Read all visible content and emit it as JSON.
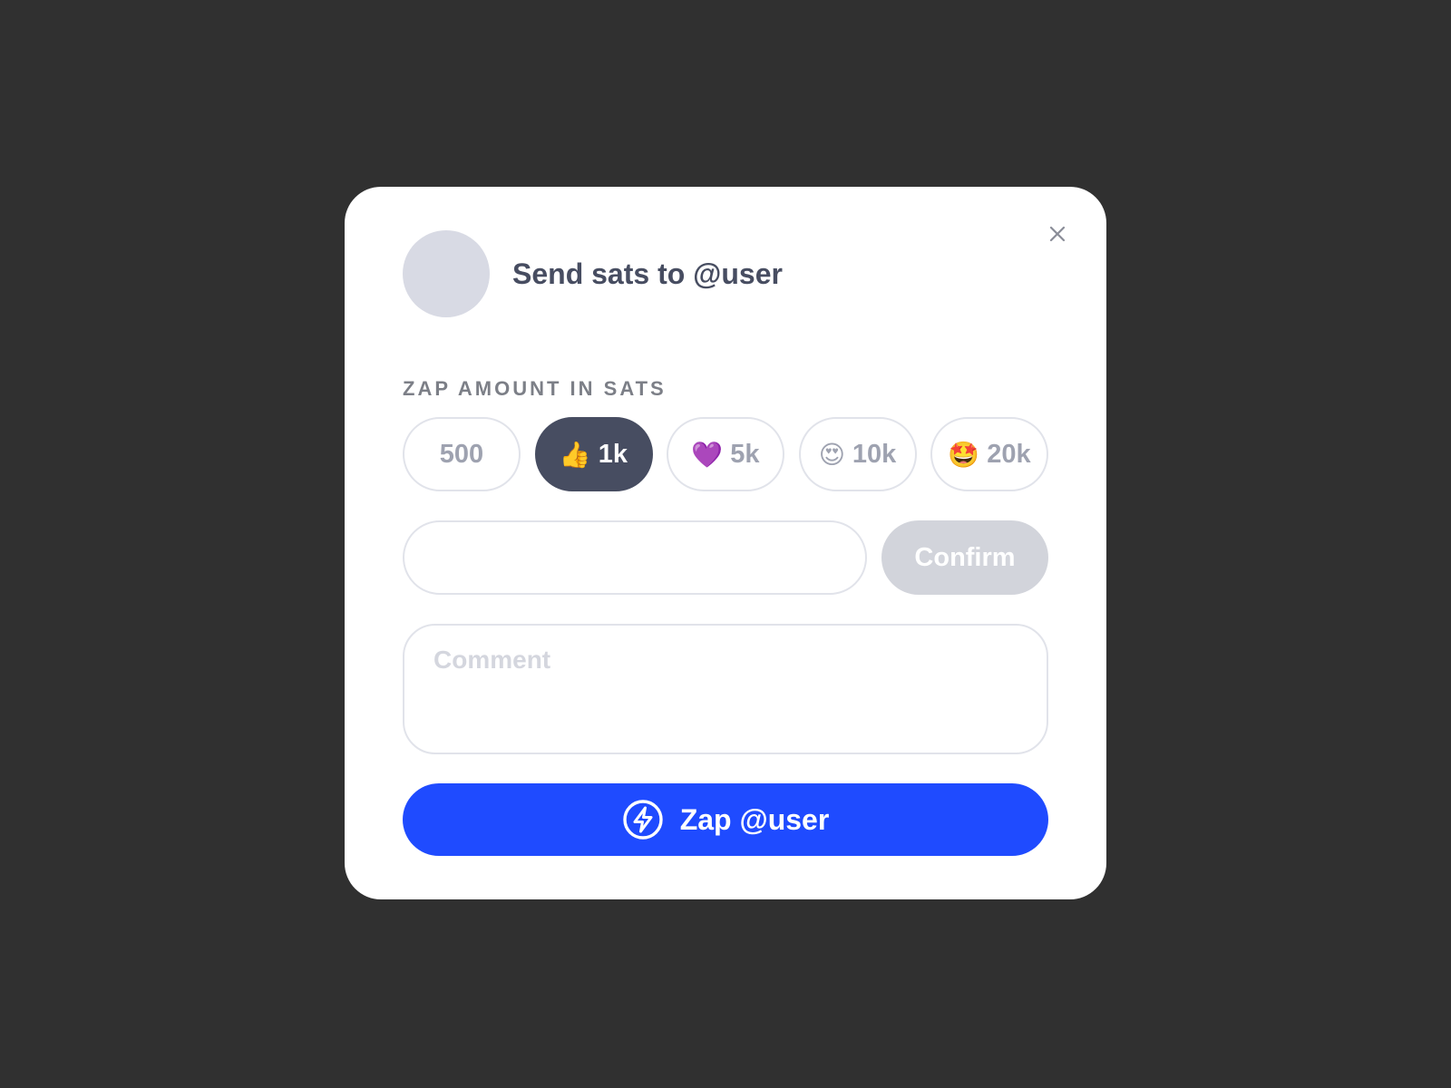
{
  "modal": {
    "title": "Send sats to @user",
    "close_icon": "close-icon",
    "avatar": "avatar-placeholder"
  },
  "amount_section": {
    "label": "ZAP AMOUNT IN SATS",
    "options": [
      {
        "emoji": "",
        "label": "500",
        "selected": false
      },
      {
        "emoji": "👍",
        "label": "1k",
        "selected": true
      },
      {
        "emoji": "💜",
        "label": "5k",
        "selected": false
      },
      {
        "emoji": "😍",
        "label": "10k",
        "selected": false
      },
      {
        "emoji": "🤩",
        "label": "20k",
        "selected": false
      }
    ]
  },
  "custom_amount": {
    "value": "",
    "placeholder": "",
    "confirm_label": "Confirm"
  },
  "comment": {
    "value": "",
    "placeholder": "Comment"
  },
  "zap_button": {
    "label": "Zap @user",
    "icon": "lightning-icon"
  },
  "colors": {
    "backdrop": "#303030",
    "accent": "#1f4bff",
    "selected_pill": "#474d61",
    "disabled_button": "#d2d4db"
  }
}
